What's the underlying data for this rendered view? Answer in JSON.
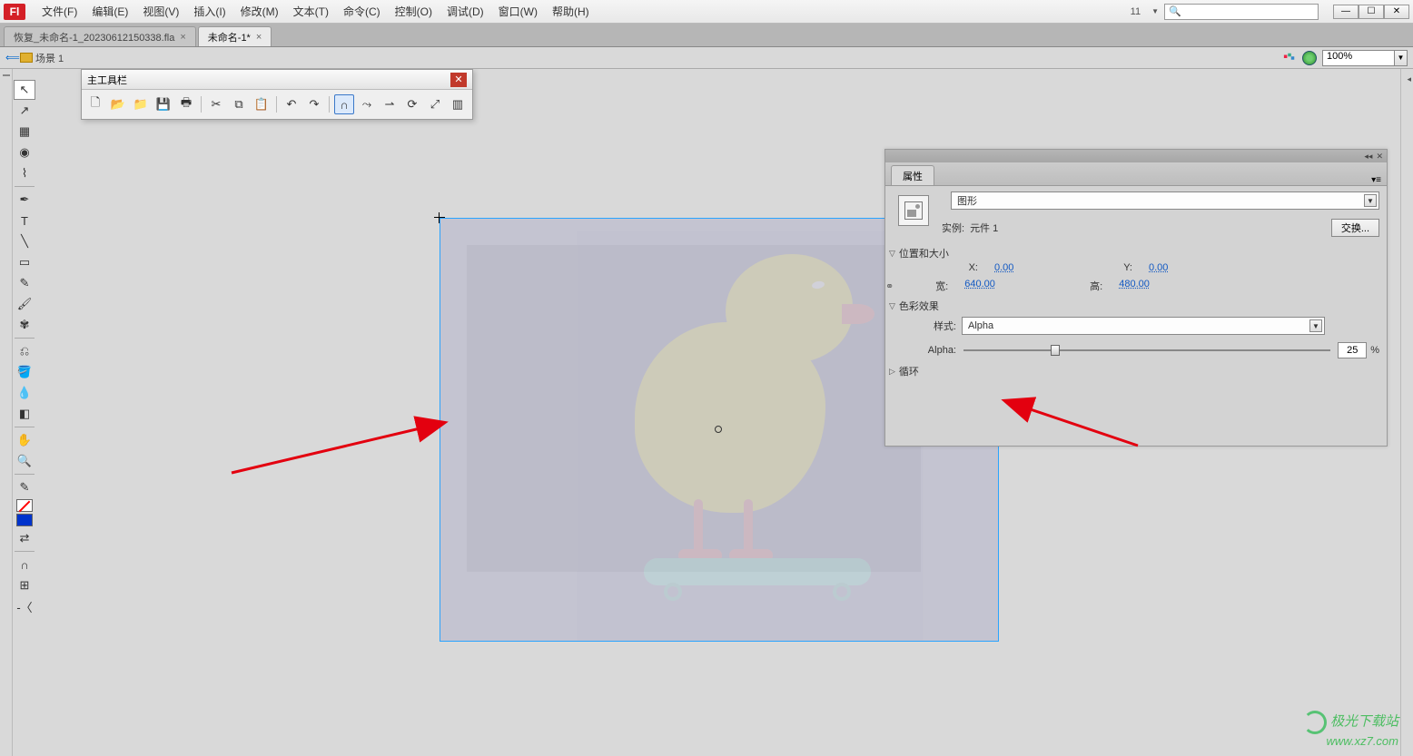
{
  "app": {
    "logo_text": "Fl"
  },
  "menus": {
    "file": "文件(F)",
    "edit": "编辑(E)",
    "view": "视图(V)",
    "insert": "插入(I)",
    "modify": "修改(M)",
    "text": "文本(T)",
    "commands": "命令(C)",
    "control": "控制(O)",
    "debug": "调试(D)",
    "window": "窗口(W)",
    "help": "帮助(H)"
  },
  "top_right": {
    "number": "11",
    "search_placeholder": ""
  },
  "tabs": [
    {
      "label": "恢复_未命名-1_20230612150338.fla",
      "active": false
    },
    {
      "label": "未命名-1*",
      "active": true
    }
  ],
  "scene": {
    "back_icon": "⟸",
    "crumb": "场景 1",
    "zoom_value": "100%"
  },
  "float_toolbar": {
    "title": "主工具栏",
    "icons": [
      "new",
      "open",
      "open-folder",
      "save",
      "print",
      "cut",
      "copy",
      "paste",
      "undo",
      "redo",
      "magnet",
      "align-left",
      "align-center",
      "align-right",
      "rotate",
      "scale",
      "group"
    ]
  },
  "properties": {
    "tab_label": "属性",
    "type_value": "图形",
    "instance_label": "实例:",
    "instance_value": "元件 1",
    "swap_label": "交换...",
    "sections": {
      "pos_size": "位置和大小",
      "color_effect": "色彩效果",
      "loop": "循环"
    },
    "pos": {
      "x_label": "X:",
      "x_value": "0.00",
      "y_label": "Y:",
      "y_value": "0.00",
      "w_label": "宽:",
      "w_value": "640.00",
      "h_label": "高:",
      "h_value": "480.00"
    },
    "style_label": "样式:",
    "style_value": "Alpha",
    "alpha_label": "Alpha:",
    "alpha_value": "25",
    "alpha_percent": "%",
    "slider_percent": 25
  },
  "watermark": {
    "cn": "极光下载站",
    "url": "www.xz7.com"
  }
}
